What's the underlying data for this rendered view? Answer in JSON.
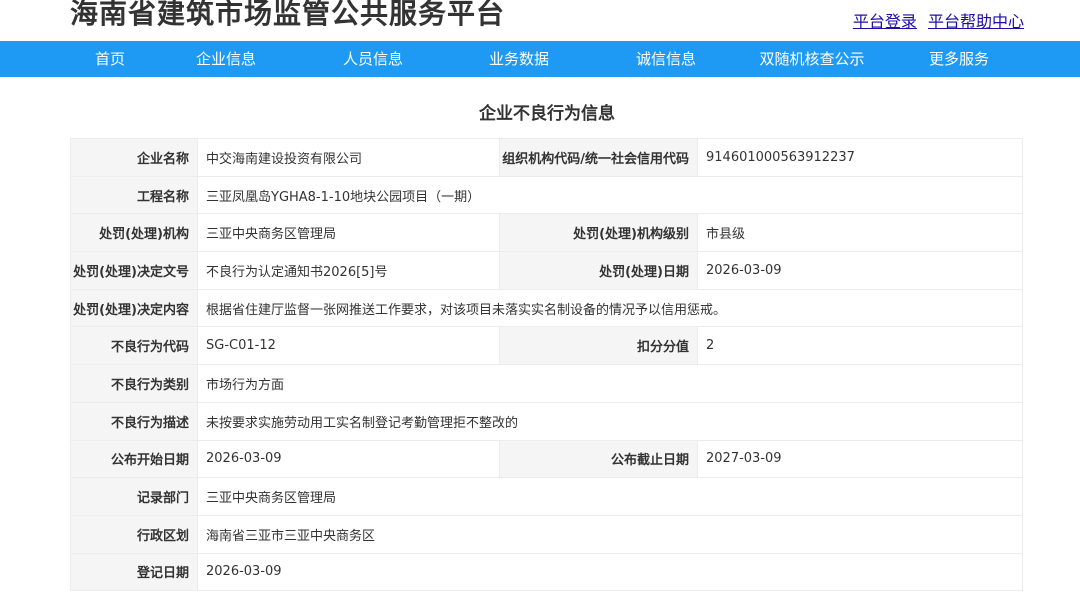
{
  "header": {
    "site_title": "海南省建筑市场监管公共服务平台",
    "links": [
      "平台登录",
      "平台帮助中心"
    ]
  },
  "nav": {
    "items": [
      "首页",
      "企业信息",
      "人员信息",
      "业务数据",
      "诚信信息",
      "双随机核查公示",
      "更多服务"
    ]
  },
  "page_title": "企业不良行为信息",
  "record": {
    "company_name_label": "企业名称",
    "company_name": "中交海南建设投资有限公司",
    "org_code_label": "组织机构代码/统一社会信用代码",
    "org_code": "914601000563912237",
    "project_label": "工程名称",
    "project": "三亚凤凰岛YGHA8-1-10地块公园项目（一期）",
    "authority_label": "处罚(处理)机构",
    "authority": "三亚中央商务区管理局",
    "authority_level_label": "处罚(处理)机构级别",
    "authority_level": "市县级",
    "decision_no_label": "处罚(处理)决定文号",
    "decision_no": "不良行为认定通知书2026[5]号",
    "decision_date_label": "处罚(处理)日期",
    "decision_date": "2026-03-09",
    "decision_content_label": "处罚(处理)决定内容",
    "decision_content": "根据省住建厅监督一张网推送工作要求，对该项目未落实实名制设备的情况予以信用惩戒。",
    "behavior_code_label": "不良行为代码",
    "behavior_code": "SG-C01-12",
    "score_label": "扣分分值",
    "score": "2",
    "behavior_category_label": "不良行为类别",
    "behavior_category": "市场行为方面",
    "behavior_desc_label": "不良行为描述",
    "behavior_desc": "未按要求实施劳动用工实名制登记考勤管理拒不整改的",
    "publish_start_label": "公布开始日期",
    "publish_start": "2026-03-09",
    "publish_end_label": "公布截止日期",
    "publish_end": "2027-03-09",
    "record_dept_label": "记录部门",
    "record_dept": "三亚中央商务区管理局",
    "admin_region_label": "行政区划",
    "admin_region": "海南省三亚市三亚中央商务区",
    "register_date_label": "登记日期",
    "register_date": "2026-03-09"
  },
  "colors": {
    "nav_bg": "#1e9af4",
    "label_bg": "#f5f5f5",
    "link": "#1a0dab"
  }
}
